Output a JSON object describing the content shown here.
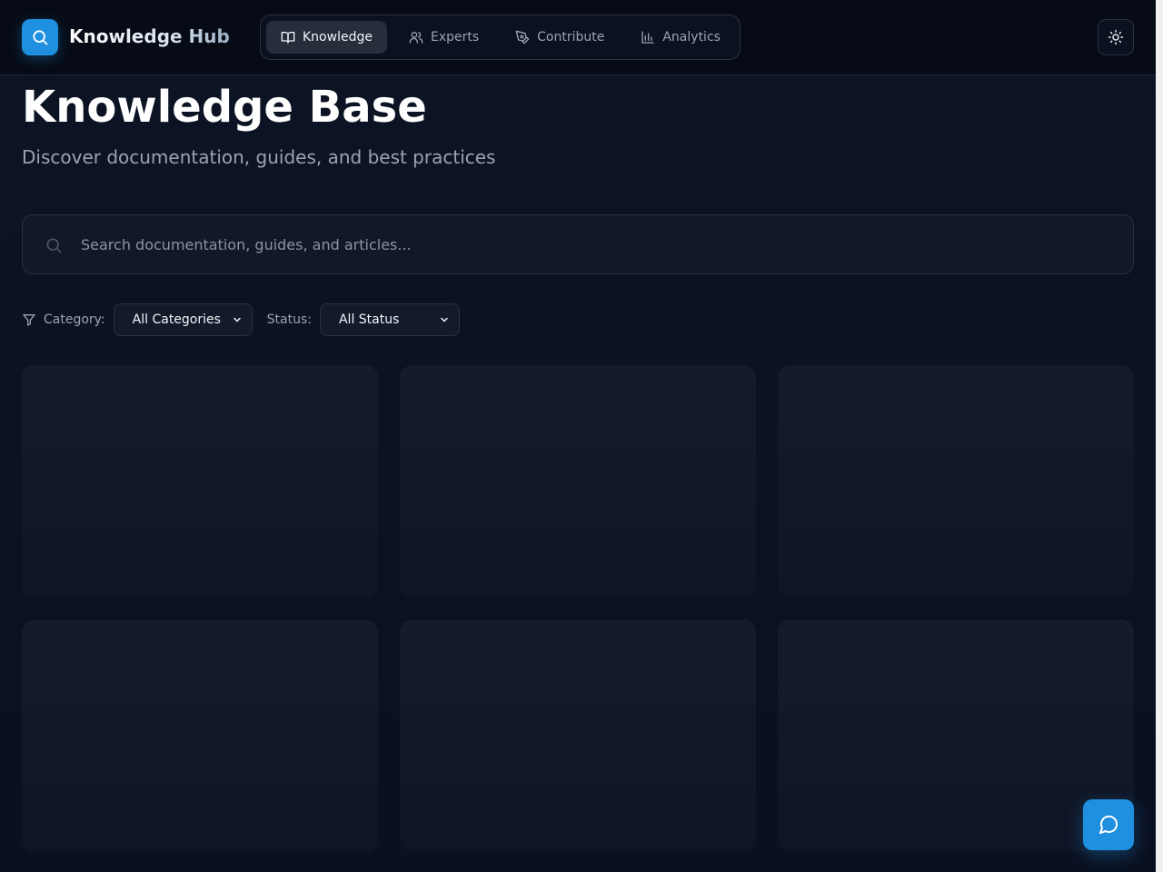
{
  "app": {
    "title": "Knowledge Hub",
    "logo_icon": "search-icon"
  },
  "nav": {
    "items": [
      {
        "label": "Knowledge",
        "icon": "book-open-icon",
        "active": true
      },
      {
        "label": "Experts",
        "icon": "users-icon",
        "active": false
      },
      {
        "label": "Contribute",
        "icon": "pen-tool-icon",
        "active": false
      },
      {
        "label": "Analytics",
        "icon": "bar-chart-icon",
        "active": false
      }
    ]
  },
  "theme_toggle": {
    "icon": "sun-icon"
  },
  "page": {
    "title": "Knowledge Base",
    "subtitle": "Discover documentation, guides, and best practices"
  },
  "search": {
    "placeholder": "Search documentation, guides, and articles...",
    "value": ""
  },
  "filters": {
    "category_label": "Category:",
    "category_value": "All Categories",
    "status_label": "Status:",
    "status_value": "All Status"
  },
  "cards": {
    "count": 6,
    "state": "loading"
  },
  "chat": {
    "icon": "message-circle-icon"
  },
  "colors": {
    "accent": "#1f8fe0",
    "background": "#0b1120",
    "card": "#141a2a",
    "border": "#2a3142",
    "muted_text": "#9ca3af"
  }
}
